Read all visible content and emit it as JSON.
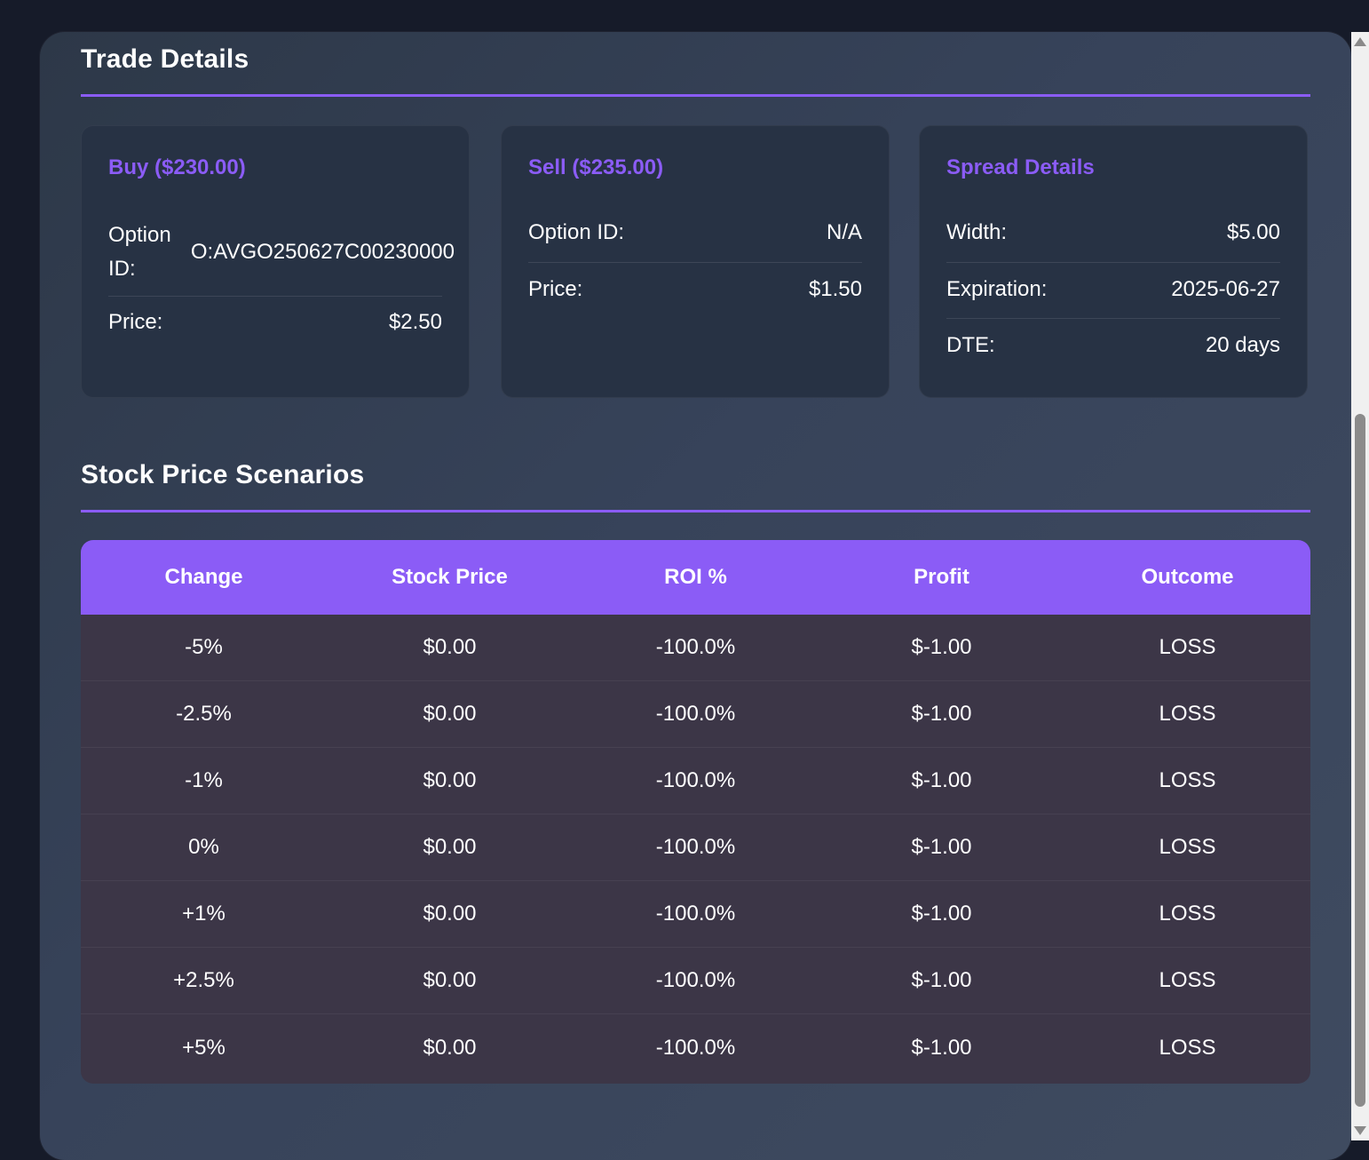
{
  "trade_details": {
    "title": "Trade Details",
    "buy": {
      "title": "Buy ($230.00)",
      "option_id_label": "Option ID:",
      "option_id_value": "O:AVGO250627C00230000",
      "price_label": "Price:",
      "price_value": "$2.50"
    },
    "sell": {
      "title": "Sell ($235.00)",
      "option_id_label": "Option ID:",
      "option_id_value": "N/A",
      "price_label": "Price:",
      "price_value": "$1.50"
    },
    "spread": {
      "title": "Spread Details",
      "width_label": "Width:",
      "width_value": "$5.00",
      "expiration_label": "Expiration:",
      "expiration_value": "2025-06-27",
      "dte_label": "DTE:",
      "dte_value": "20 days"
    }
  },
  "scenarios": {
    "title": "Stock Price Scenarios",
    "columns": [
      "Change",
      "Stock Price",
      "ROI %",
      "Profit",
      "Outcome"
    ],
    "rows": [
      [
        "-5%",
        "$0.00",
        "-100.0%",
        "$-1.00",
        "LOSS"
      ],
      [
        "-2.5%",
        "$0.00",
        "-100.0%",
        "$-1.00",
        "LOSS"
      ],
      [
        "-1%",
        "$0.00",
        "-100.0%",
        "$-1.00",
        "LOSS"
      ],
      [
        "0%",
        "$0.00",
        "-100.0%",
        "$-1.00",
        "LOSS"
      ],
      [
        "+1%",
        "$0.00",
        "-100.0%",
        "$-1.00",
        "LOSS"
      ],
      [
        "+2.5%",
        "$0.00",
        "-100.0%",
        "$-1.00",
        "LOSS"
      ],
      [
        "+5%",
        "$0.00",
        "-100.0%",
        "$-1.00",
        "LOSS"
      ]
    ]
  },
  "colors": {
    "accent": "#8b5cf6",
    "card_bg": "#273244",
    "table_row_bg": "#3c3647"
  }
}
